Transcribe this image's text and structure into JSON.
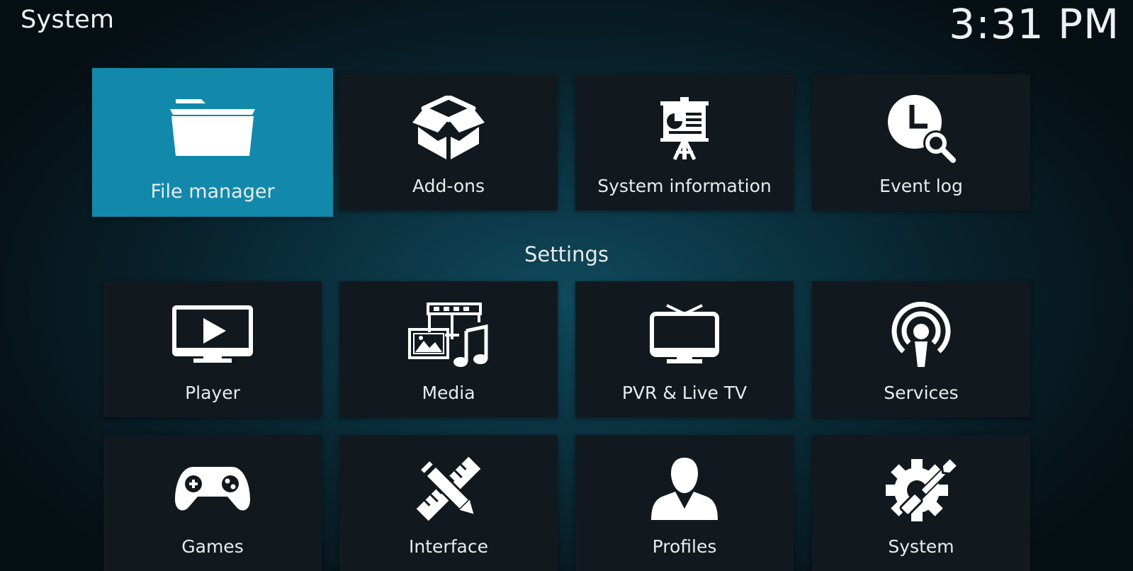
{
  "header": {
    "title": "System",
    "clock": "3:31 PM"
  },
  "top_row": [
    {
      "label": "File manager",
      "icon": "folder-icon"
    },
    {
      "label": "Add-ons",
      "icon": "addons-box-icon"
    },
    {
      "label": "System information",
      "icon": "presentation-board-icon"
    },
    {
      "label": "Event log",
      "icon": "clock-search-icon"
    }
  ],
  "settings": {
    "heading": "Settings",
    "row1": [
      {
        "label": "Player",
        "icon": "tv-play-icon"
      },
      {
        "label": "Media",
        "icon": "media-filmstrip-icon"
      },
      {
        "label": "PVR & Live TV",
        "icon": "tv-antenna-icon"
      },
      {
        "label": "Services",
        "icon": "podcast-icon"
      }
    ],
    "row2": [
      {
        "label": "Games",
        "icon": "gamepad-icon"
      },
      {
        "label": "Interface",
        "icon": "pencil-ruler-icon"
      },
      {
        "label": "Profiles",
        "icon": "person-icon"
      },
      {
        "label": "System",
        "icon": "gear-wrench-icon"
      }
    ]
  },
  "colors": {
    "focus": "#1289aa",
    "tile": "#12191e"
  }
}
